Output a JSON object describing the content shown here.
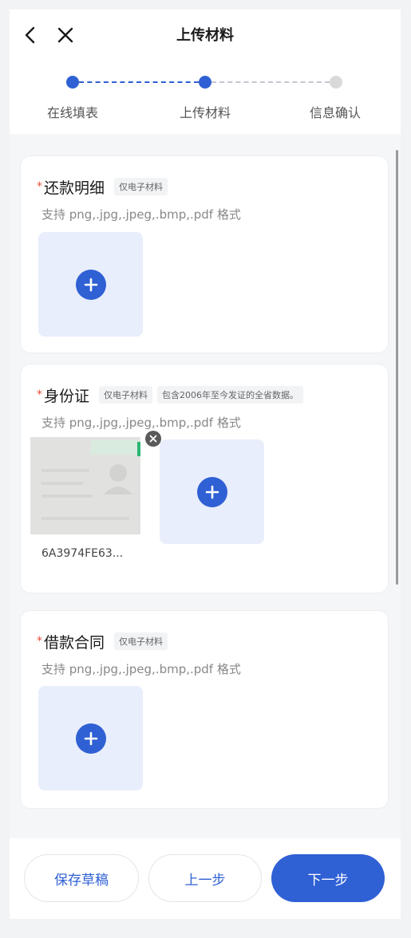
{
  "header": {
    "title": "上传材料",
    "back_icon": "chevron-left-icon",
    "close_icon": "close-icon"
  },
  "steps": [
    {
      "label": "在线填表",
      "state": "done"
    },
    {
      "label": "上传材料",
      "state": "current"
    },
    {
      "label": "信息确认",
      "state": "pending"
    }
  ],
  "sections": [
    {
      "title": "还款明细",
      "required_mark": "*",
      "tags": [
        "仅电子材料"
      ],
      "hint": "支持 png,.jpg,.jpeg,.bmp,.pdf 格式"
    },
    {
      "title": "身份证",
      "required_mark": "*",
      "tags": [
        "仅电子材料",
        "包含2006年至今发证的全省数据。"
      ],
      "hint": "支持 png,.jpg,.jpeg,.bmp,.pdf 格式",
      "uploaded_file_name": "6A3974FE63..."
    },
    {
      "title": "借款合同",
      "required_mark": "*",
      "tags": [
        "仅电子材料"
      ],
      "hint": "支持 png,.jpg,.jpeg,.bmp,.pdf 格式"
    }
  ],
  "footer": {
    "save_draft": "保存草稿",
    "prev_step": "上一步",
    "next_step": "下一步"
  },
  "colors": {
    "primary": "#2f60d4",
    "required": "#e84b3c",
    "upload_bg": "#e8eefb"
  }
}
